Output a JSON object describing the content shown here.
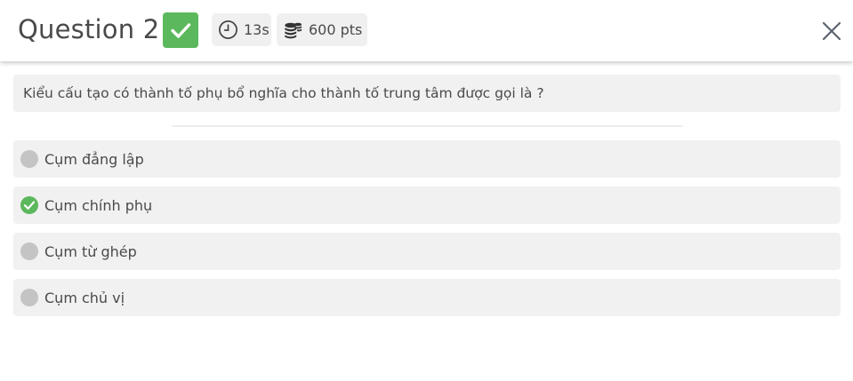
{
  "header": {
    "title": "Question 2",
    "status_icon": "check-icon",
    "time": "13s",
    "points": "600 pts",
    "close_icon": "close-icon"
  },
  "question": {
    "text": "Kiểu cấu tạo có thành tố phụ bổ nghĩa cho thành tố trung tâm được gọi là ?"
  },
  "options": [
    {
      "label": "Cụm đẳng lập",
      "state": "unselected"
    },
    {
      "label": "Cụm chính phụ",
      "state": "correct"
    },
    {
      "label": "Cụm từ ghép",
      "state": "unselected"
    },
    {
      "label": "Cụm chủ vị",
      "state": "unselected"
    }
  ],
  "colors": {
    "correct": "#5cb85c",
    "neutral_dot": "#c4c4c4",
    "panel_bg": "#f1f1f1"
  }
}
